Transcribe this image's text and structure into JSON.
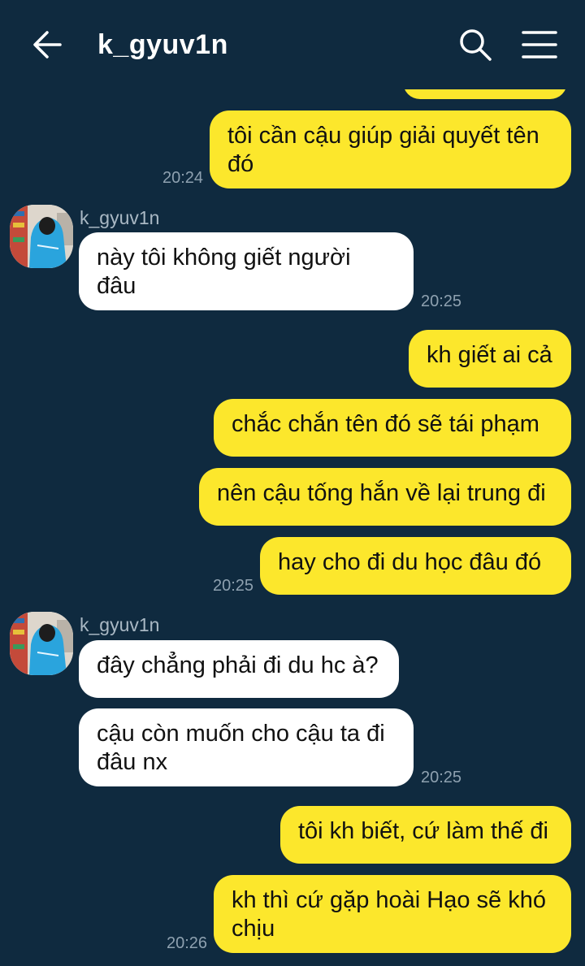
{
  "header": {
    "title": "k_gyuv1n",
    "back_icon": "arrow-left-icon",
    "search_icon": "search-icon",
    "menu_icon": "hamburger-menu-icon"
  },
  "colors": {
    "background": "#0f2a3f",
    "my_bubble": "#fce72c",
    "their_bubble": "#ffffff"
  },
  "messages": [
    {
      "from": "me",
      "text": "tôi cần cậu giúp giải quyết tên đó",
      "time": "20:24"
    },
    {
      "from": "them",
      "sender": "k_gyuv1n",
      "text": "này tôi không giết người đâu",
      "time": "20:25"
    },
    {
      "from": "me",
      "text": "kh giết ai cả"
    },
    {
      "from": "me",
      "text": "chắc chắn tên đó sẽ tái phạm"
    },
    {
      "from": "me",
      "text": "nên cậu tống hắn về lại trung đi"
    },
    {
      "from": "me",
      "text": "hay cho đi du học đâu đó",
      "time": "20:25"
    },
    {
      "from": "them",
      "sender": "k_gyuv1n",
      "text": "đây chẳng phải đi du hc à?"
    },
    {
      "from": "them",
      "text": "cậu còn muốn cho cậu ta đi đâu nx",
      "time": "20:25"
    },
    {
      "from": "me",
      "text": "tôi kh biết, cứ làm thế đi"
    },
    {
      "from": "me",
      "text": "kh thì cứ gặp hoài Hạo sẽ khó chịu",
      "time": "20:26"
    }
  ]
}
